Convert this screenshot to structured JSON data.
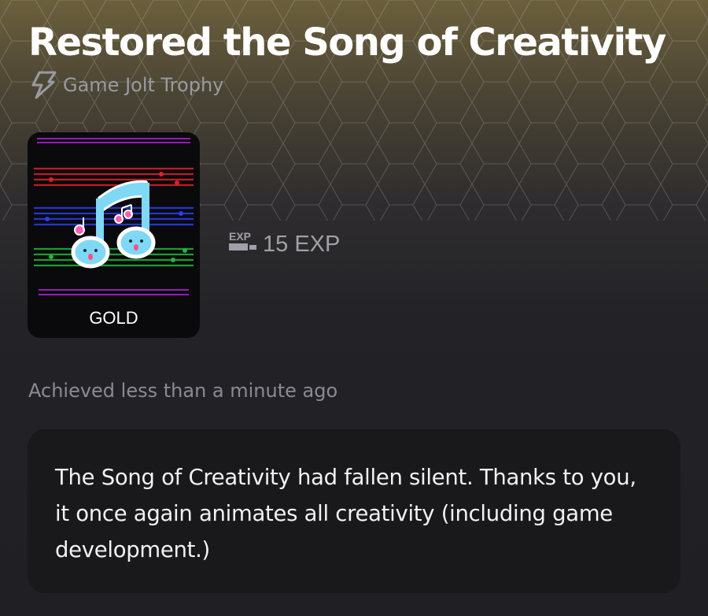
{
  "trophy": {
    "title": "Restored the Song of Creativity",
    "source": "Game Jolt Trophy",
    "tier": "GOLD",
    "exp_icon_text": "EXP",
    "exp_value": "15 EXP",
    "achieved": "Achieved less than a minute ago",
    "description": "The Song of Creativity had fallen silent. Thanks to you, it once again animates all creativity (including game development.)"
  },
  "colors": {
    "accent_bg_top": "#6b5f3c",
    "bg": "#202024",
    "card": "#19191c",
    "note_cyan": "#7fd8f4",
    "note_pink": "#ff5fb0"
  },
  "icons": {
    "source": "game-jolt-bolt-icon",
    "exp": "exp-icon",
    "trophy_art": "music-notes-icon"
  }
}
